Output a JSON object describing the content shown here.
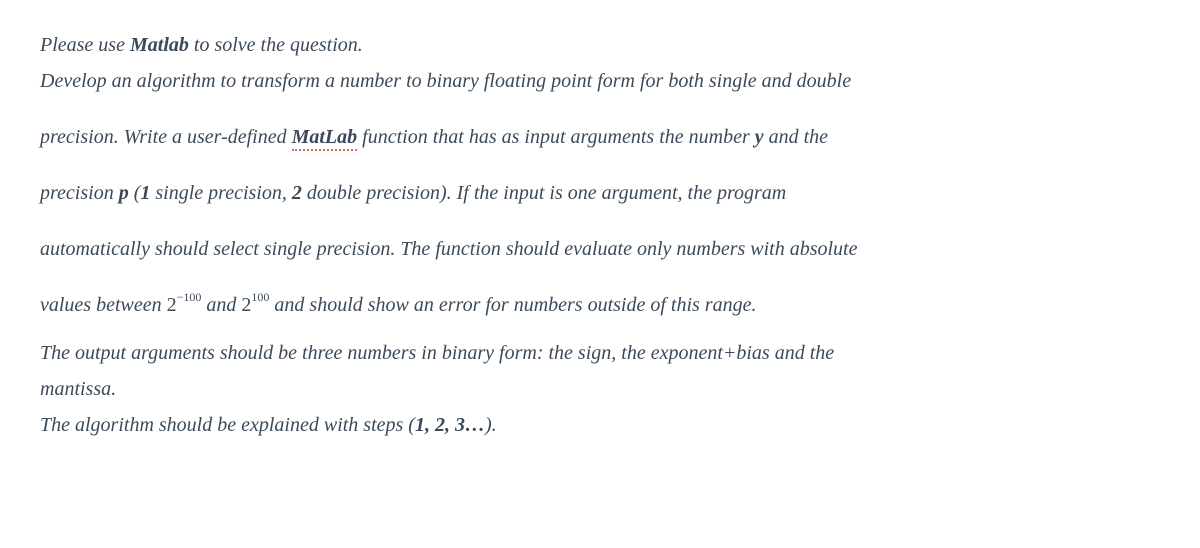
{
  "line1": {
    "t1": "Please use ",
    "t2": "Matlab",
    "t3": " to solve the question."
  },
  "line2": "Develop an algorithm to transform a number to binary floating point form for both single and double",
  "line3": {
    "t1": "precision. Write a user-defined ",
    "t2": "MatLab",
    "t3": " function that has as input arguments the number ",
    "t4": "y",
    "t5": " and the"
  },
  "line4": {
    "t1": "precision ",
    "t2": "p",
    "t3": " (",
    "t4": "1",
    "t5": " single precision, ",
    "t6": "2",
    "t7": " double precision). If the input is one argument, the program"
  },
  "line5": "automatically should select single precision. The function should evaluate only numbers with absolute",
  "line6": {
    "t1": "values between ",
    "base1": "2",
    "exp1": "−100",
    "t2": " and ",
    "base2": "2",
    "exp2": "100",
    "t3": " and should show an error for numbers outside of this range."
  },
  "line7": "The output arguments should be three numbers in binary form: the sign, the exponent+bias and the",
  "line8": "mantissa.",
  "line9": {
    "t1": "The algorithm should be explained with steps (",
    "t2": "1, 2, 3…",
    "t3": ")."
  }
}
